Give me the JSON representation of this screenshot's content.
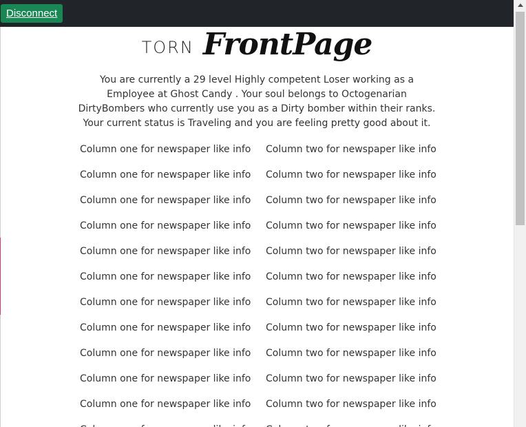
{
  "navbar": {
    "disconnect_label": "Disconnect"
  },
  "header": {
    "title_prefix": "TORN",
    "title_main": "FrontPage"
  },
  "intro": {
    "text": "You are currently a 29 level Highly competent Loser working as a Employee at Ghost Candy . Your soul belongs to Octogenarian DirtyBombers who currently use you as a Dirty bomber within their ranks. Your current status is Traveling and you are feeling pretty good about it."
  },
  "columns": {
    "col_one_text": "Column one for newspaper like info",
    "col_two_text": "Column two for newspaper like info",
    "row_count": 12
  },
  "colors": {
    "navbar_bg": "#212529",
    "button_bg": "#198754"
  }
}
